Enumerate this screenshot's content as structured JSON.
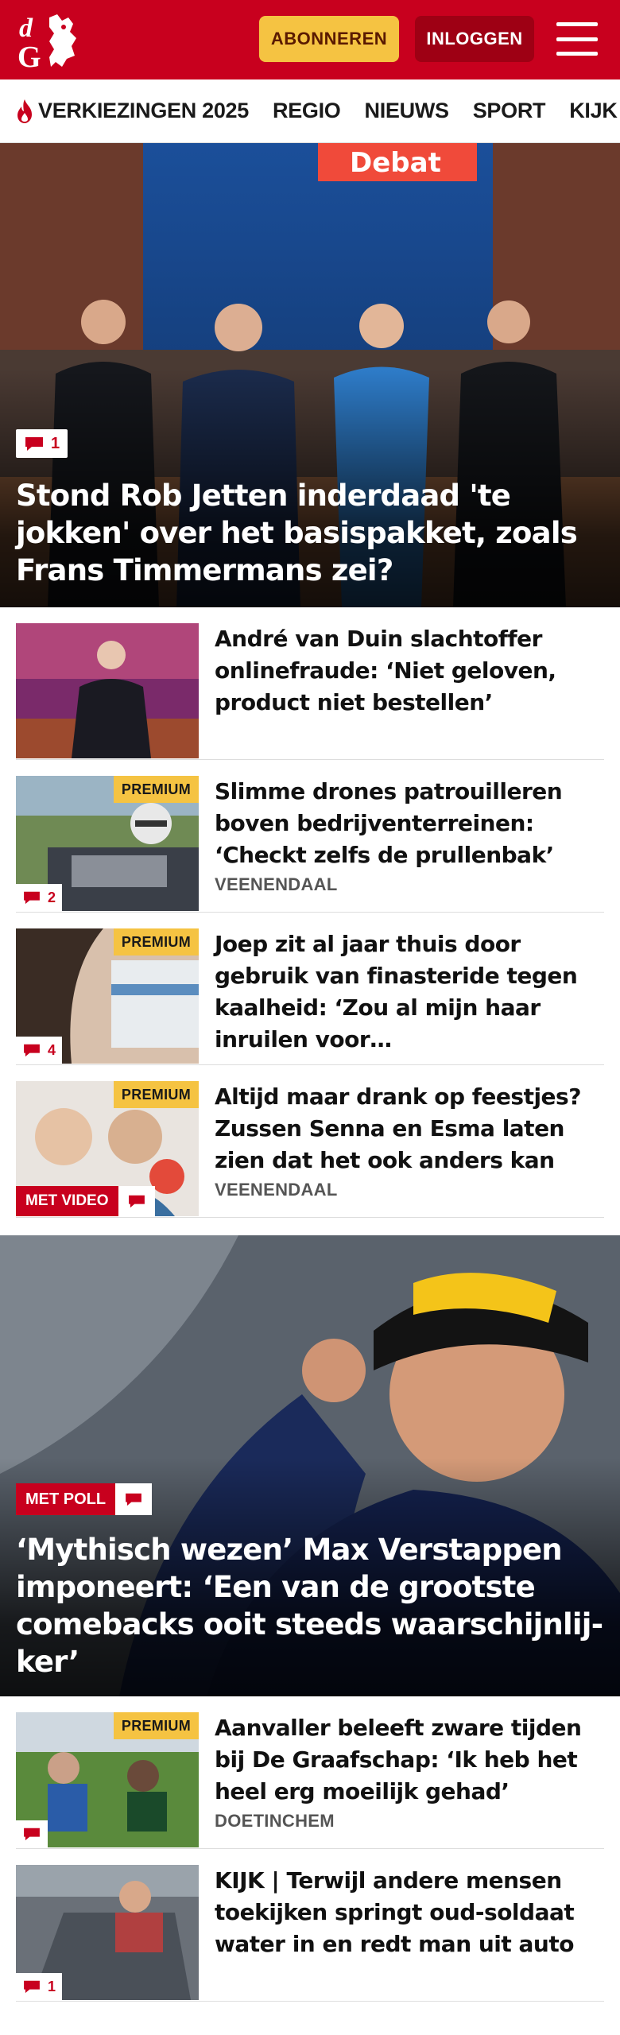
{
  "brand": {
    "logo_text": "dG",
    "primary_color": "#c8001e",
    "accent_color": "#f5c342"
  },
  "header": {
    "subscribe_label": "ABONNEREN",
    "login_label": "INLOGGEN"
  },
  "nav": {
    "items": [
      {
        "label": "VERKIEZINGEN 2025",
        "icon": "flame-icon"
      },
      {
        "label": "REGIO"
      },
      {
        "label": "NIEUWS"
      },
      {
        "label": "SPORT"
      },
      {
        "label": "KIJK"
      }
    ]
  },
  "hero": {
    "image_banner_text": "Debat",
    "comment_count": "1",
    "title": "Stond Rob Jetten inderdaad 'te jokken' over het basispakket, zoals Frans Timmermans zei?"
  },
  "articles": [
    {
      "title": "André van Duin slachtoffer onlinefraude: ‘Niet geloven, product niet bestellen’",
      "location": "",
      "premium": false,
      "comments": "",
      "video": false
    },
    {
      "title": "Slimme drones patrouilleren boven bedrijventerreinen: ‘Checkt zelfs de prullenbak’",
      "location": "VEENENDAAL",
      "premium": true,
      "premium_label": "PREMIUM",
      "comments": "2",
      "video": false
    },
    {
      "title": "Joep zit al jaar thuis door gebruik van finasteride tegen kaalheid: ‘Zou al mijn haar inruilen voor…",
      "location": "",
      "premium": true,
      "premium_label": "PREMIUM",
      "comments": "4",
      "video": false
    },
    {
      "title": "Altijd maar drank op feestjes? Zussen Senna en Esma laten zien dat het ook anders kan",
      "location": "VEENENDAAL",
      "premium": true,
      "premium_label": "PREMIUM",
      "comments": "",
      "video": true,
      "video_label": "MET VIDEO"
    }
  ],
  "hero2": {
    "poll_label": "MET POLL",
    "title": "‘Mythisch wezen’ Max Verstappen imponeert: ‘Een van de grootste comebacks ooit steeds waarschijnlij-ker’"
  },
  "articles2": [
    {
      "title": "Aanvaller beleeft zware tijden bij De Graafschap: ‘Ik heb het heel erg moeilijk gehad’",
      "location": "DOETINCHEM",
      "premium": true,
      "premium_label": "PREMIUM",
      "comments": ""
    },
    {
      "title": "KIJK | Terwijl andere mensen toekijken springt oud-soldaat water in en redt man uit auto",
      "location": "",
      "premium": false,
      "comments": "1"
    }
  ]
}
